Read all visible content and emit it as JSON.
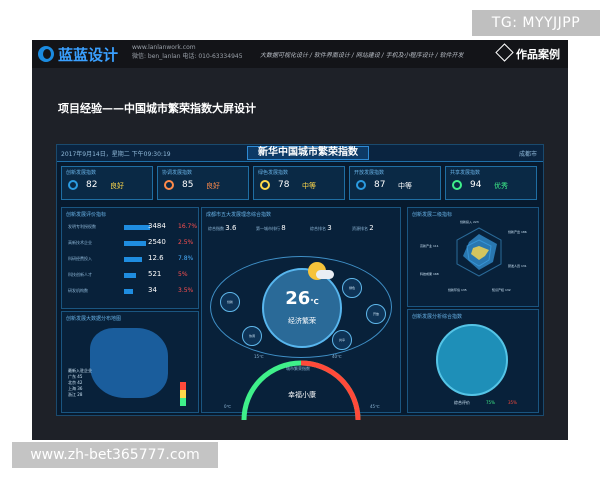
{
  "watermarks": {
    "top": "TG: MYYJJPP",
    "bottom": "www.zh-bet365777.com"
  },
  "site": {
    "logo": "蓝蓝设计",
    "contact_url": "www.lanlanwork.com",
    "contact_line": "微信: ben_lanlan  电话: 010-63334945",
    "nav": [
      "大数据可视化设计",
      "软件界面设计",
      "网站建设",
      "手机及小程序设计",
      "软件开发"
    ],
    "works": "作品案例"
  },
  "project_title": "项目经验——中国城市繁荣指数大屏设计",
  "dashboard": {
    "date": "2017年9月14日，星期二  下午09:30:19",
    "title": "新华中国城市繁荣指数",
    "city": "成都市",
    "kpis": [
      {
        "label": "创新发展指数",
        "value": "82",
        "status": "良好",
        "color": "#ffd84a"
      },
      {
        "label": "协调发展指数",
        "value": "85",
        "status": "良好",
        "color": "#ff8a4a"
      },
      {
        "label": "绿色发展指数",
        "value": "78",
        "status": "中等",
        "color": "#ffd84a"
      },
      {
        "label": "开放发展指数",
        "value": "87",
        "status": "中等",
        "color": "#ffffff"
      },
      {
        "label": "共享发展指数",
        "value": "94",
        "status": "优秀",
        "color": "#3ff08a"
      }
    ],
    "review_panel": {
      "title": "创新发展评价指标",
      "rows": [
        {
          "name": "发明专利授权数",
          "value": "3484",
          "change": "16.7%"
        },
        {
          "name": "高新技术企业",
          "value": "2540",
          "change": "2.5%"
        },
        {
          "name": "科研经费投入",
          "value": "12.6",
          "change": "7.8%"
        },
        {
          "name": "科技创新人才",
          "value": "521",
          "change": "5%"
        },
        {
          "name": "研发机构数",
          "value": "34",
          "change": "3.5%"
        }
      ]
    },
    "center": {
      "title": "成都市五大发展理念综合指数",
      "stats": [
        {
          "label": "综合指数",
          "value": "3.6"
        },
        {
          "label": "第一城市排行",
          "value": "8"
        },
        {
          "label": "综合排名",
          "value": "3"
        },
        {
          "label": "资源排名",
          "value": "2"
        }
      ],
      "temperature": "26",
      "temperature_unit": "℃",
      "prosperity": "经济繁荣",
      "bubbles": [
        "创新",
        "协调",
        "绿色",
        "开放",
        "共享"
      ],
      "gauge_title": "城市繁荣指数",
      "gauge_label": "幸福小康",
      "gauge_ticks": [
        "0℃",
        "15℃",
        "40℃",
        "45℃"
      ]
    },
    "map_panel": {
      "title": "创新发展大数据分布地图",
      "legend": [
        "最新入驻企业",
        "广东 45",
        "北京 42",
        "上海 36",
        "浙江 28"
      ]
    },
    "radar_panel": {
      "title": "创新发展二级指标",
      "labels": [
        "创新投入 223",
        "创新产出 186",
        "高新产业 111",
        "研发人员 131",
        "科技成果 168",
        "创新环境 135",
        "知识产权 132"
      ]
    },
    "globe_panel": {
      "title": "创新发展分析综合指数",
      "legend": [
        "综合评价",
        "75%",
        "35%"
      ]
    }
  }
}
